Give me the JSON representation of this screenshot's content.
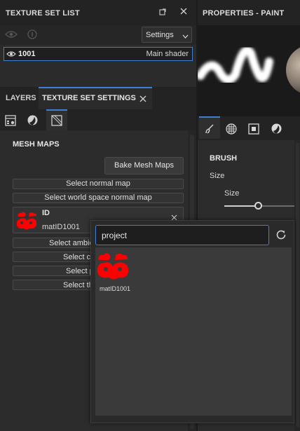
{
  "texture_set_list": {
    "title": "TEXTURE SET LIST",
    "settings_label": "Settings",
    "item": {
      "name": "1001",
      "shader": "Main shader"
    }
  },
  "properties": {
    "title": "PROPERTIES - PAINT",
    "brush_section": "BRUSH",
    "size_label": "Size",
    "size_sub_label": "Size"
  },
  "tabs": {
    "layers": "LAYERS",
    "texture_set_settings": "TEXTURE SET SETTINGS"
  },
  "mesh_maps": {
    "section_title": "MESH MAPS",
    "bake_button": "Bake Mesh Maps",
    "select_normal": "Select normal map",
    "select_world_normal": "Select world space normal map",
    "id_label": "ID",
    "id_value": "matID1001",
    "select_ambient": "Select ambie",
    "select_curvature": "Select cu",
    "select_position": "Select p",
    "select_thickness": "Select th"
  },
  "popup": {
    "search_value": "project",
    "result_label": "matID1001"
  },
  "colors": {
    "accent": "#3f7fd3",
    "id_map_red": "#ff0000"
  }
}
